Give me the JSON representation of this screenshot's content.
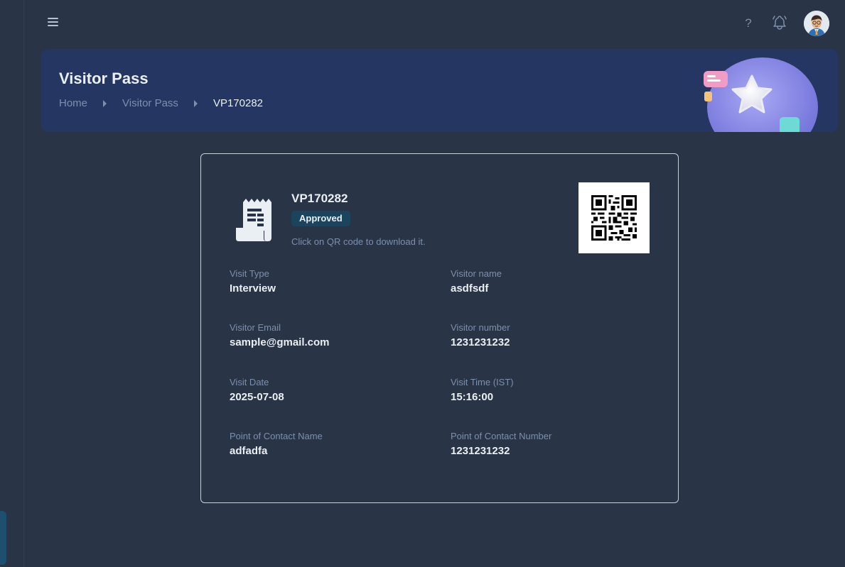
{
  "header": {
    "menu_icon": "hamburger-icon",
    "help_icon": "question-icon",
    "help_glyph": "?",
    "notification_icon": "bell-icon",
    "avatar_icon": "user-avatar"
  },
  "banner": {
    "title": "Visitor Pass",
    "breadcrumb": [
      "Home",
      "Visitor Pass",
      "VP170282"
    ]
  },
  "pass": {
    "id": "VP170282",
    "status": "Approved",
    "qr_hint": "Click on QR code to download it.",
    "icon": "receipt-icon"
  },
  "fields": [
    {
      "label": "Visit Type",
      "value": "Interview"
    },
    {
      "label": "Visitor name",
      "value": "asdfsdf"
    },
    {
      "label": "Visitor Email",
      "value": "sample@gmail.com"
    },
    {
      "label": "Visitor number",
      "value": "1231231232"
    },
    {
      "label": "Visit Date",
      "value": "2025-07-08"
    },
    {
      "label": "Visit Time (IST)",
      "value": "15:16:00"
    },
    {
      "label": "Point of Contact Name",
      "value": "adfadfa"
    },
    {
      "label": "Point of Contact Number",
      "value": "1231231232"
    }
  ],
  "colors": {
    "background": "#2a3447",
    "banner": "#253662",
    "badge": "#1c455d",
    "muted_text": "#7c8fac",
    "primary_text": "#eaeff4"
  }
}
